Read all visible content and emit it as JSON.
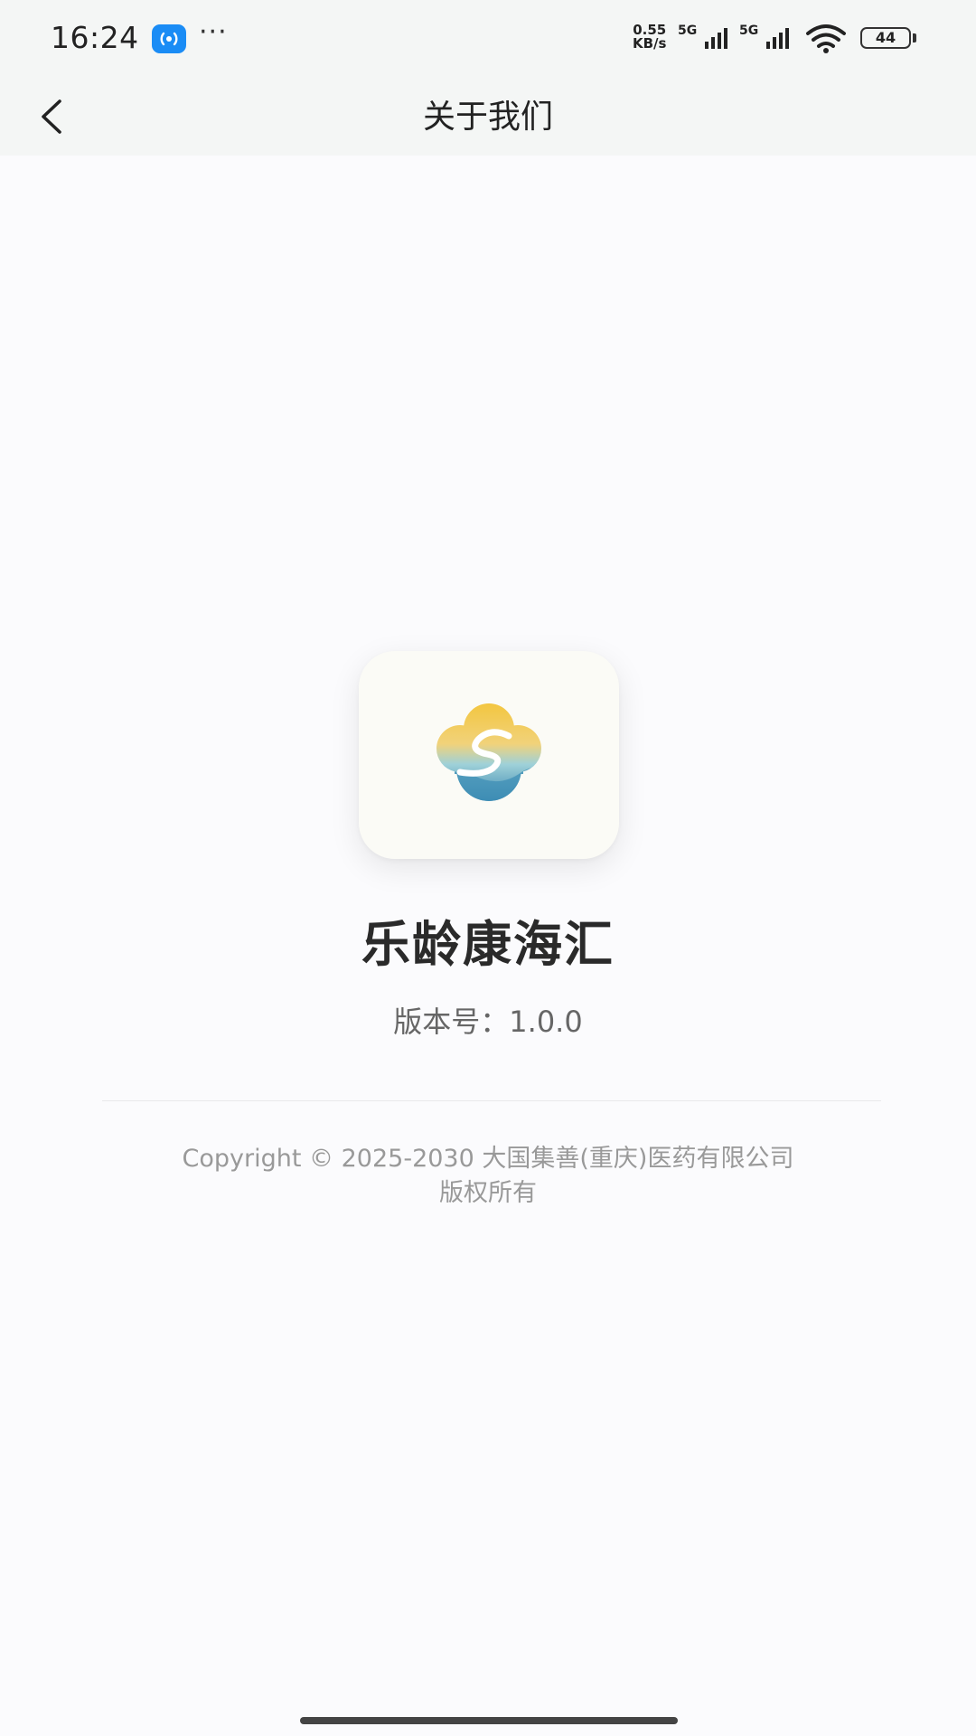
{
  "status_bar": {
    "time": "16:24",
    "app_badge_icon": "hotspot-icon",
    "more": "···",
    "net_speed_value": "0.55",
    "net_speed_unit": "KB/s",
    "sim1_network": "5G",
    "sim2_network": "5G",
    "wifi_icon": "wifi-icon",
    "battery_level": "44"
  },
  "nav": {
    "title": "关于我们",
    "back_icon": "chevron-left-icon"
  },
  "app": {
    "logo_icon": "cloud-logo-icon",
    "name": "乐龄康海汇",
    "version": "版本号：1.0.0"
  },
  "footer": {
    "copyright_line1": "Copyright © 2025-2030 大国集善(重庆)医药有限公司",
    "copyright_line2": "版权所有"
  },
  "colors": {
    "bar_background": "#f4f6f5",
    "page_background": "#fbfbfd",
    "badge_blue": "#1a8cf5",
    "logo_gold": "#f2c649",
    "logo_blue": "#3f8fb6"
  }
}
